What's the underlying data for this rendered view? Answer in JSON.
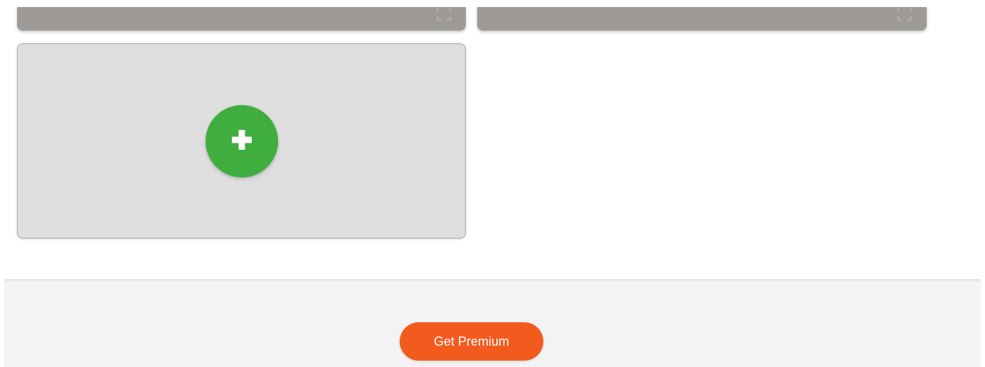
{
  "cards": [
    {
      "icon": "expand-icon"
    },
    {
      "icon": "expand-icon"
    }
  ],
  "add_tile": {
    "icon": "plus-icon",
    "button_color": "#3fae3f"
  },
  "footer": {
    "premium_label": "Get Premium",
    "premium_color": "#f35a1e"
  }
}
